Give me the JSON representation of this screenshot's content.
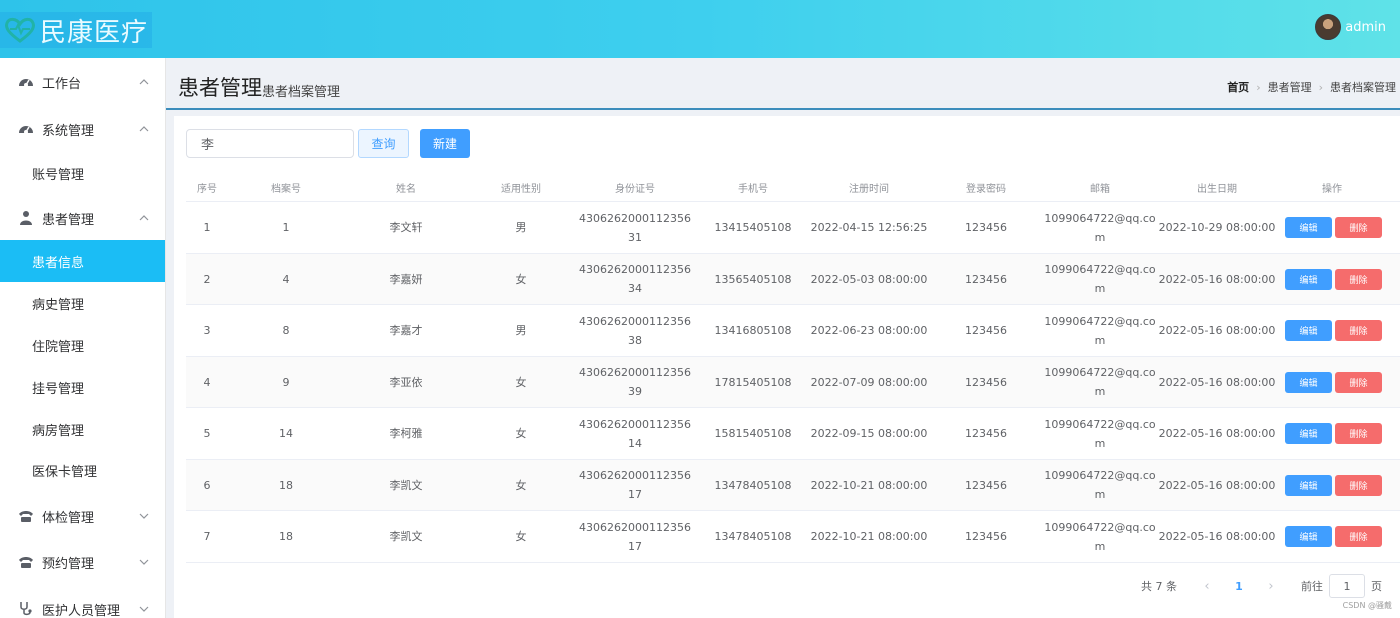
{
  "header": {
    "logo_text": "民康医疗",
    "user_name": "admin"
  },
  "sidebar": {
    "groups": [
      {
        "label": "工作台",
        "icon": "dashboard-icon",
        "expanded": true
      },
      {
        "label": "系统管理",
        "icon": "dashboard-icon",
        "expanded": true
      },
      {
        "label": "患者管理",
        "icon": "user-group-icon",
        "expanded": true
      },
      {
        "label": "体检管理",
        "icon": "phone-icon",
        "expanded": false
      },
      {
        "label": "预约管理",
        "icon": "phone-icon",
        "expanded": false
      },
      {
        "label": "医护人员管理",
        "icon": "stethoscope-icon",
        "expanded": false
      }
    ],
    "sub_items": [
      {
        "label": "账号管理",
        "active": false
      },
      {
        "label": "患者信息",
        "active": true
      },
      {
        "label": "病史管理",
        "active": false
      },
      {
        "label": "住院管理",
        "active": false
      },
      {
        "label": "挂号管理",
        "active": false
      },
      {
        "label": "病房管理",
        "active": false
      },
      {
        "label": "医保卡管理",
        "active": false
      }
    ]
  },
  "page": {
    "title": "患者管理",
    "subtitle": "患者档案管理",
    "breadcrumb": [
      "首页",
      "患者管理",
      "患者档案管理"
    ]
  },
  "toolbar": {
    "search_value": "李",
    "query_label": "查询",
    "new_label": "新建"
  },
  "table": {
    "headers": [
      "序号",
      "档案号",
      "姓名",
      "适用性别",
      "身份证号",
      "手机号",
      "注册时间",
      "登录密码",
      "邮箱",
      "出生日期",
      "操作"
    ],
    "rows": [
      {
        "no": "1",
        "file_no": "1",
        "name": "李文轩",
        "gender": "男",
        "id_card_1": "4306262000112356",
        "id_card_2": "31",
        "phone": "13415405108",
        "reg_time": "2022-04-15 12:56:25",
        "password": "123456",
        "email_1": "1099064722@qq.co",
        "email_2": "m",
        "birth": "2022-10-29 08:00:00"
      },
      {
        "no": "2",
        "file_no": "4",
        "name": "李嘉妍",
        "gender": "女",
        "id_card_1": "4306262000112356",
        "id_card_2": "34",
        "phone": "13565405108",
        "reg_time": "2022-05-03 08:00:00",
        "password": "123456",
        "email_1": "1099064722@qq.co",
        "email_2": "m",
        "birth": "2022-05-16 08:00:00"
      },
      {
        "no": "3",
        "file_no": "8",
        "name": "李嘉才",
        "gender": "男",
        "id_card_1": "4306262000112356",
        "id_card_2": "38",
        "phone": "13416805108",
        "reg_time": "2022-06-23 08:00:00",
        "password": "123456",
        "email_1": "1099064722@qq.co",
        "email_2": "m",
        "birth": "2022-05-16 08:00:00"
      },
      {
        "no": "4",
        "file_no": "9",
        "name": "李亚依",
        "gender": "女",
        "id_card_1": "4306262000112356",
        "id_card_2": "39",
        "phone": "17815405108",
        "reg_time": "2022-07-09 08:00:00",
        "password": "123456",
        "email_1": "1099064722@qq.co",
        "email_2": "m",
        "birth": "2022-05-16 08:00:00"
      },
      {
        "no": "5",
        "file_no": "14",
        "name": "李柯雅",
        "gender": "女",
        "id_card_1": "4306262000112356",
        "id_card_2": "14",
        "phone": "15815405108",
        "reg_time": "2022-09-15 08:00:00",
        "password": "123456",
        "email_1": "1099064722@qq.co",
        "email_2": "m",
        "birth": "2022-05-16 08:00:00"
      },
      {
        "no": "6",
        "file_no": "18",
        "name": "李凯文",
        "gender": "女",
        "id_card_1": "4306262000112356",
        "id_card_2": "17",
        "phone": "13478405108",
        "reg_time": "2022-10-21 08:00:00",
        "password": "123456",
        "email_1": "1099064722@qq.co",
        "email_2": "m",
        "birth": "2022-05-16 08:00:00"
      },
      {
        "no": "7",
        "file_no": "18",
        "name": "李凯文",
        "gender": "女",
        "id_card_1": "4306262000112356",
        "id_card_2": "17",
        "phone": "13478405108",
        "reg_time": "2022-10-21 08:00:00",
        "password": "123456",
        "email_1": "1099064722@qq.co",
        "email_2": "m",
        "birth": "2022-05-16 08:00:00"
      }
    ],
    "edit_label": "编辑",
    "delete_label": "删除"
  },
  "pagination": {
    "total_text": "共 7 条",
    "current_page": "1",
    "goto_label": "前往",
    "goto_value": "1",
    "page_suffix": "页"
  },
  "watermark": "CSDN @骚戴",
  "colors": {
    "header_start": "#2ec3ea",
    "header_end": "#5fe2e8",
    "active_menu": "#1bbdf5",
    "primary": "#409eff",
    "danger": "#f56c6c"
  }
}
